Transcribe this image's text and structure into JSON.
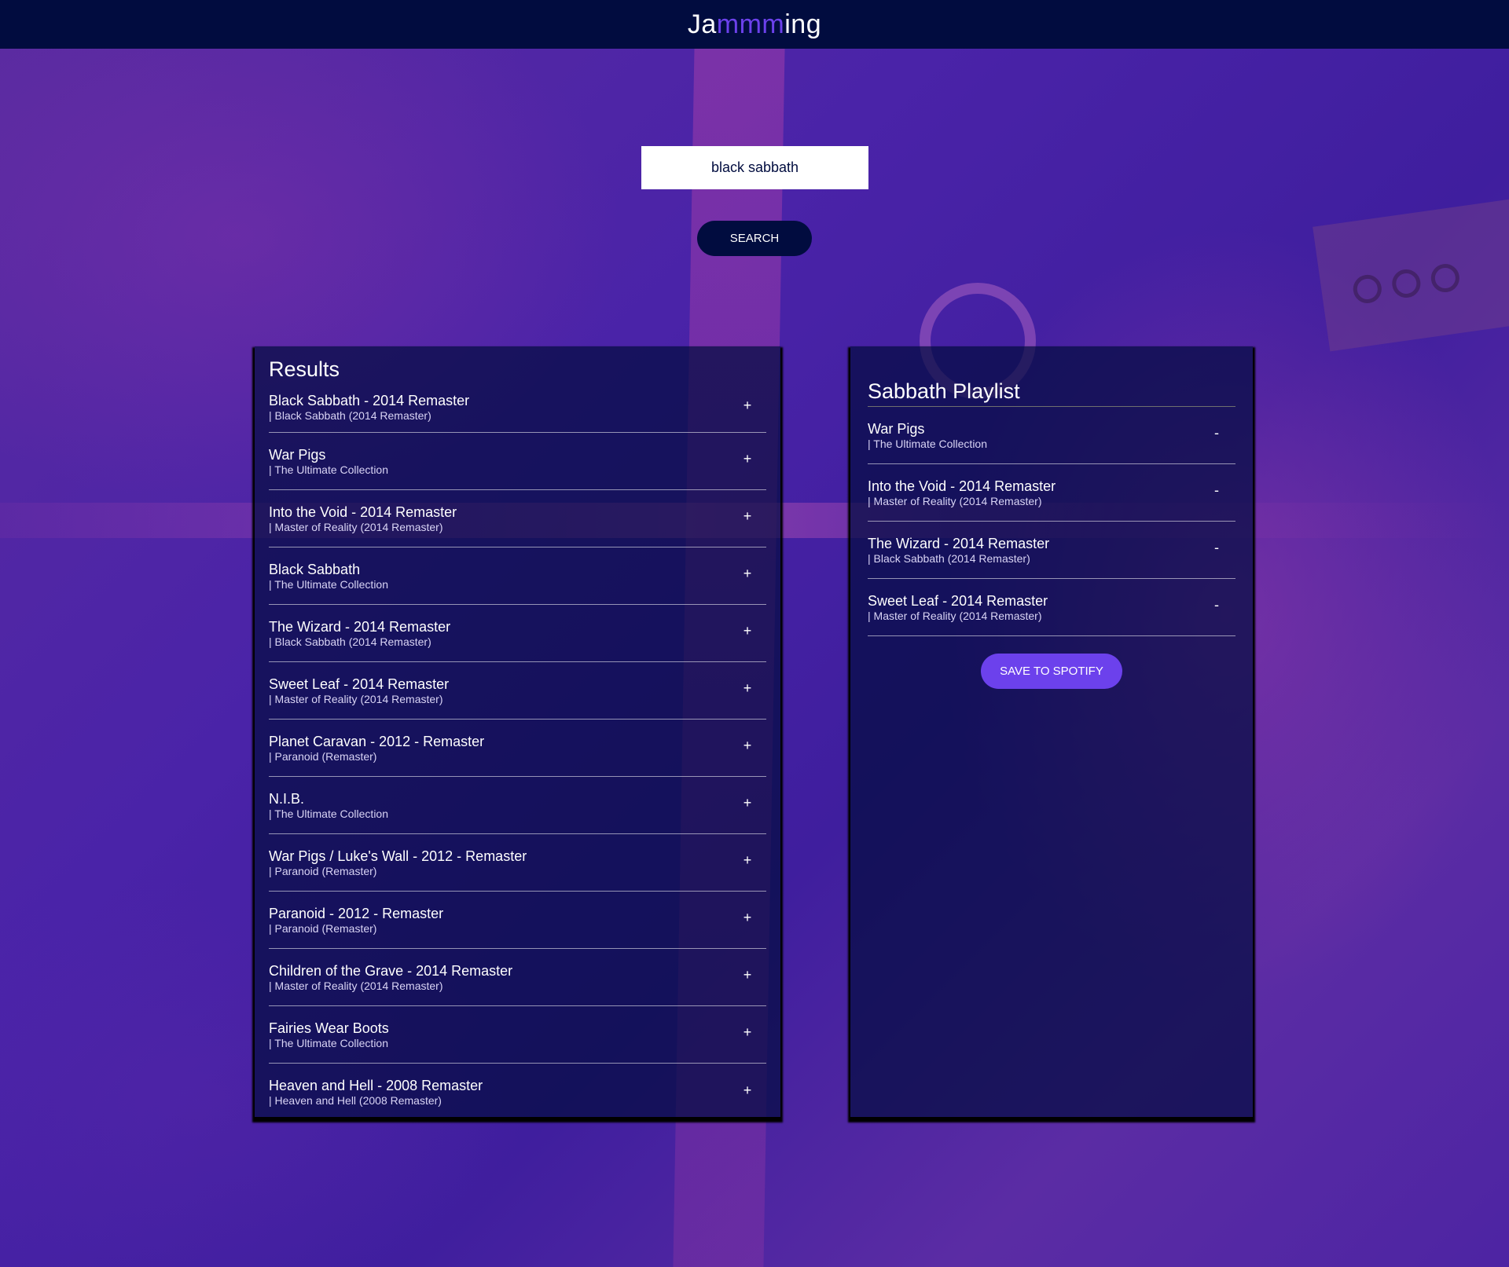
{
  "app": {
    "title_prefix": "Ja",
    "title_highlight": "mmm",
    "title_suffix": "ing"
  },
  "colors": {
    "header_bg": "#010c3f",
    "accent": "#6c41ec",
    "panel_bg": "#010c3f"
  },
  "search": {
    "value": "black sabbath",
    "button_label": "SEARCH"
  },
  "results": {
    "title": "Results",
    "action_symbol": "+",
    "tracks": [
      {
        "name": "Black Sabbath - 2014 Remaster",
        "meta": "| Black Sabbath (2014 Remaster)"
      },
      {
        "name": "War Pigs",
        "meta": "| The Ultimate Collection"
      },
      {
        "name": "Into the Void - 2014 Remaster",
        "meta": "| Master of Reality (2014 Remaster)"
      },
      {
        "name": "Black Sabbath",
        "meta": "| The Ultimate Collection"
      },
      {
        "name": "The Wizard - 2014 Remaster",
        "meta": "| Black Sabbath (2014 Remaster)"
      },
      {
        "name": "Sweet Leaf - 2014 Remaster",
        "meta": "| Master of Reality (2014 Remaster)"
      },
      {
        "name": "Planet Caravan - 2012 - Remaster",
        "meta": "| Paranoid (Remaster)"
      },
      {
        "name": "N.I.B.",
        "meta": "| The Ultimate Collection"
      },
      {
        "name": "War Pigs / Luke's Wall - 2012 - Remaster",
        "meta": "| Paranoid (Remaster)"
      },
      {
        "name": "Paranoid - 2012 - Remaster",
        "meta": "| Paranoid (Remaster)"
      },
      {
        "name": "Children of the Grave - 2014 Remaster",
        "meta": "| Master of Reality (2014 Remaster)"
      },
      {
        "name": "Fairies Wear Boots",
        "meta": "| The Ultimate Collection"
      },
      {
        "name": "Heaven and Hell - 2008 Remaster",
        "meta": "| Heaven and Hell (2008 Remaster)"
      }
    ]
  },
  "playlist": {
    "name": "Sabbath Playlist",
    "action_symbol": "-",
    "save_label": "SAVE TO SPOTIFY",
    "tracks": [
      {
        "name": "War Pigs",
        "meta": "| The Ultimate Collection"
      },
      {
        "name": "Into the Void - 2014 Remaster",
        "meta": "| Master of Reality (2014 Remaster)"
      },
      {
        "name": "The Wizard - 2014 Remaster",
        "meta": "| Black Sabbath (2014 Remaster)"
      },
      {
        "name": "Sweet Leaf - 2014 Remaster",
        "meta": "| Master of Reality (2014 Remaster)"
      }
    ]
  }
}
